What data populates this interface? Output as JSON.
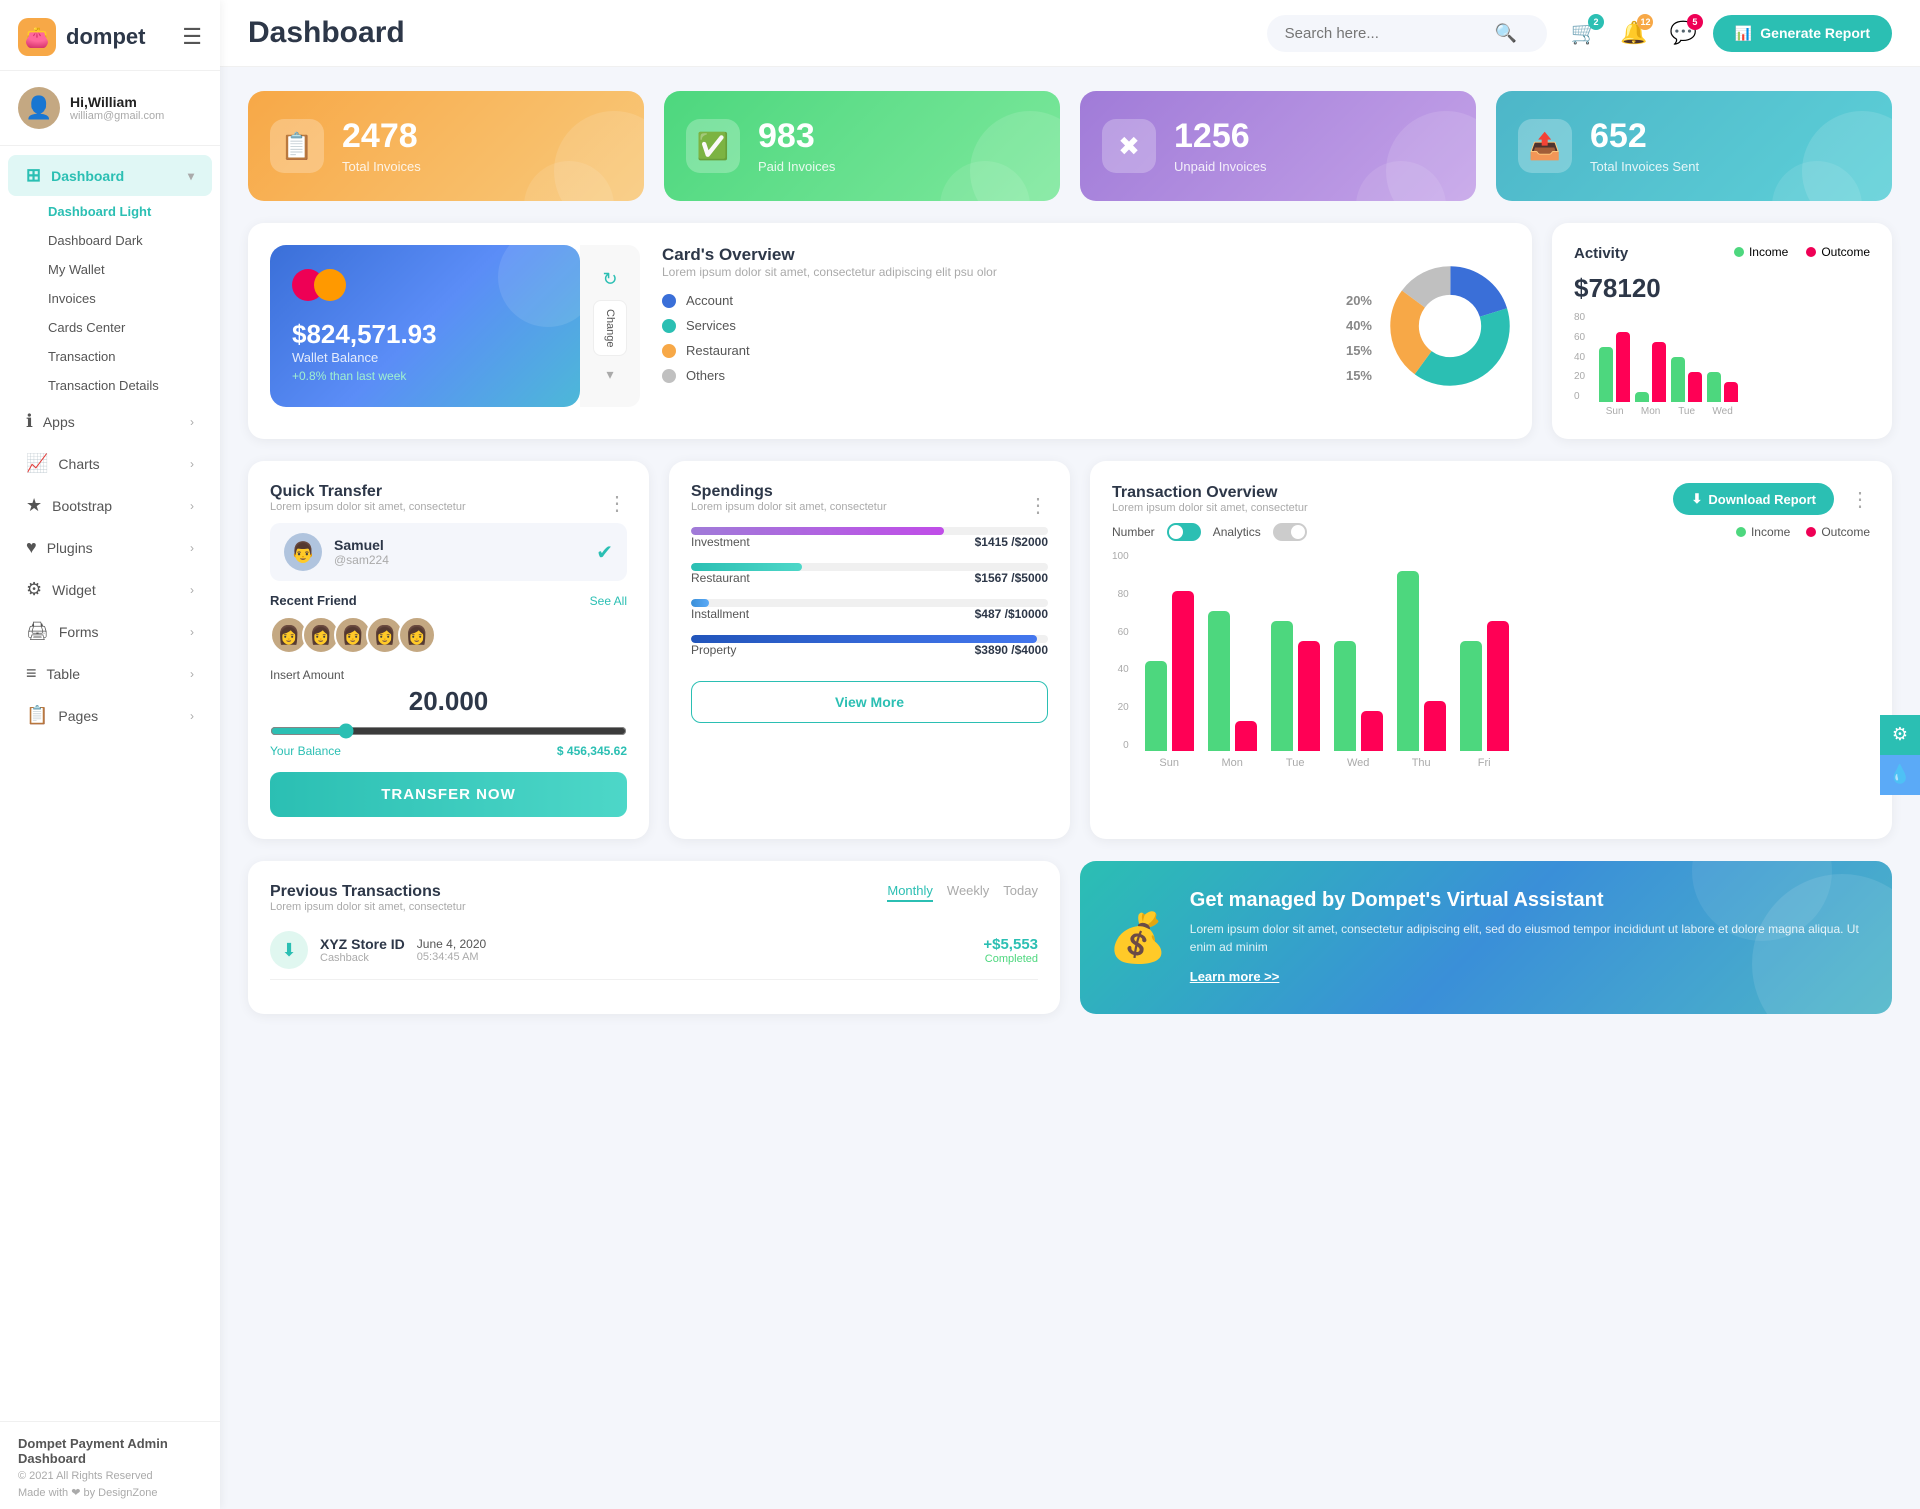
{
  "app": {
    "logo_text": "dompet",
    "logo_emoji": "👛"
  },
  "header": {
    "title": "Dashboard",
    "search_placeholder": "Search here...",
    "generate_btn": "Generate Report",
    "badge_cart": "2",
    "badge_notif": "12",
    "badge_msg": "5"
  },
  "user": {
    "name": "Hi,William",
    "email": "william@gmail.com",
    "avatar_emoji": "👤"
  },
  "sidebar": {
    "active_section": "Dashboard",
    "items": [
      {
        "label": "Dashboard",
        "icon": "⊞",
        "active": true,
        "has_arrow": true
      },
      {
        "label": "Apps",
        "icon": "ℹ",
        "active": false,
        "has_arrow": true
      },
      {
        "label": "Charts",
        "icon": "📈",
        "active": false,
        "has_arrow": true
      },
      {
        "label": "Bootstrap",
        "icon": "★",
        "active": false,
        "has_arrow": true
      },
      {
        "label": "Plugins",
        "icon": "♥",
        "active": false,
        "has_arrow": true
      },
      {
        "label": "Widget",
        "icon": "⚙",
        "active": false,
        "has_arrow": true
      },
      {
        "label": "Forms",
        "icon": "🖨",
        "active": false,
        "has_arrow": true
      },
      {
        "label": "Table",
        "icon": "≡",
        "active": false,
        "has_arrow": true
      },
      {
        "label": "Pages",
        "icon": "📋",
        "active": false,
        "has_arrow": true
      }
    ],
    "sub_items": [
      {
        "label": "Dashboard Light",
        "active": true
      },
      {
        "label": "Dashboard Dark",
        "active": false
      },
      {
        "label": "My Wallet",
        "active": false
      },
      {
        "label": "Invoices",
        "active": false
      },
      {
        "label": "Cards Center",
        "active": false
      },
      {
        "label": "Transaction",
        "active": false
      },
      {
        "label": "Transaction Details",
        "active": false
      }
    ],
    "footer": {
      "brand": "Dompet Payment Admin Dashboard",
      "copy": "© 2021 All Rights Reserved",
      "made_with": "Made with ❤ by DesignZone"
    }
  },
  "stat_cards": [
    {
      "value": "2478",
      "label": "Total Invoices",
      "icon": "📋",
      "color": "orange"
    },
    {
      "value": "983",
      "label": "Paid Invoices",
      "icon": "✅",
      "color": "green"
    },
    {
      "value": "1256",
      "label": "Unpaid Invoices",
      "icon": "✖",
      "color": "purple"
    },
    {
      "value": "652",
      "label": "Total Invoices Sent",
      "icon": "📤",
      "color": "teal"
    }
  ],
  "wallet": {
    "balance": "$824,571.93",
    "label": "Wallet Balance",
    "change": "+0.8% than last week",
    "change_btn": "Change"
  },
  "card_overview": {
    "title": "Card's Overview",
    "subtitle": "Lorem ipsum dolor sit amet, consectetur adipiscing elit psu olor",
    "items": [
      {
        "label": "Account",
        "pct": "20%",
        "color": "blue"
      },
      {
        "label": "Services",
        "pct": "40%",
        "color": "teal"
      },
      {
        "label": "Restaurant",
        "pct": "15%",
        "color": "orange"
      },
      {
        "label": "Others",
        "pct": "15%",
        "color": "gray"
      }
    ],
    "donut": {
      "segments": [
        {
          "pct": 20,
          "color": "#3a6fd8"
        },
        {
          "pct": 40,
          "color": "#2bbfb3"
        },
        {
          "pct": 25,
          "color": "#f7a847"
        },
        {
          "pct": 15,
          "color": "#c0c0c0"
        }
      ]
    }
  },
  "activity": {
    "title": "Activity",
    "value": "$78120",
    "legend": [
      {
        "label": "Income",
        "color": "green"
      },
      {
        "label": "Outcome",
        "color": "red"
      }
    ],
    "bars": [
      {
        "day": "Sun",
        "income": 55,
        "outcome": 70
      },
      {
        "day": "Mon",
        "income": 10,
        "outcome": 60
      },
      {
        "day": "Tue",
        "income": 45,
        "outcome": 30
      },
      {
        "day": "Wed",
        "income": 30,
        "outcome": 20
      }
    ]
  },
  "quick_transfer": {
    "title": "Quick Transfer",
    "subtitle": "Lorem ipsum dolor sit amet, consectetur",
    "user": {
      "name": "Samuel",
      "handle": "@sam224",
      "avatar": "👨"
    },
    "friends_label": "Recent Friend",
    "see_all": "See All",
    "friends": [
      "👩",
      "👩",
      "👩",
      "👩",
      "👩"
    ],
    "amount_label": "Insert Amount",
    "amount": "20.000",
    "balance_label": "Your Balance",
    "balance": "$ 456,345.62",
    "transfer_btn": "TRANSFER NOW"
  },
  "spendings": {
    "title": "Spendings",
    "subtitle": "Lorem ipsum dolor sit amet, consectetur",
    "items": [
      {
        "name": "Investment",
        "current": "$1415",
        "total": "/$2000",
        "pct": 71,
        "color": "fill-purple"
      },
      {
        "name": "Restaurant",
        "current": "$1567",
        "total": "/$5000",
        "pct": 31,
        "color": "fill-teal"
      },
      {
        "name": "Installment",
        "current": "$487",
        "total": "/$10000",
        "pct": 5,
        "color": "fill-blue"
      },
      {
        "name": "Property",
        "current": "$3890",
        "total": "/$4000",
        "pct": 97,
        "color": "fill-dark-blue"
      }
    ],
    "view_more_btn": "View More"
  },
  "transaction_overview": {
    "title": "Transaction Overview",
    "subtitle": "Lorem ipsum dolor sit amet, consectetur",
    "download_btn": "Download Report",
    "toggle_number": "Number",
    "toggle_analytics": "Analytics",
    "legend": [
      {
        "label": "Income",
        "color": "green"
      },
      {
        "label": "Outcome",
        "color": "red"
      }
    ],
    "bars": [
      {
        "day": "Sun",
        "income": 45,
        "outcome": 80
      },
      {
        "day": "Mon",
        "income": 70,
        "outcome": 15
      },
      {
        "day": "Tue",
        "income": 65,
        "outcome": 55
      },
      {
        "day": "Wed",
        "income": 55,
        "outcome": 20
      },
      {
        "day": "Thu",
        "income": 90,
        "outcome": 25
      },
      {
        "day": "Fri",
        "income": 55,
        "outcome": 65
      }
    ],
    "y_labels": [
      "100",
      "80",
      "60",
      "40",
      "20",
      "0"
    ]
  },
  "prev_transactions": {
    "title": "Previous Transactions",
    "subtitle": "Lorem ipsum dolor sit amet, consectetur",
    "tabs": [
      "Monthly",
      "Weekly",
      "Today"
    ],
    "active_tab": "Monthly",
    "items": [
      {
        "icon": "⬇",
        "name": "XYZ Store ID",
        "sub": "Cashback",
        "date": "June 4, 2020",
        "time": "05:34:45 AM",
        "amount": "+$5,553",
        "status": "Completed"
      }
    ]
  },
  "virtual_assistant": {
    "title": "Get managed by Dompet's Virtual Assistant",
    "text": "Lorem ipsum dolor sit amet, consectetur adipiscing elit, sed do eiusmod tempor incididunt ut labore et dolore magna aliqua. Ut enim ad minim",
    "link": "Learn more >>",
    "icon": "💰"
  }
}
